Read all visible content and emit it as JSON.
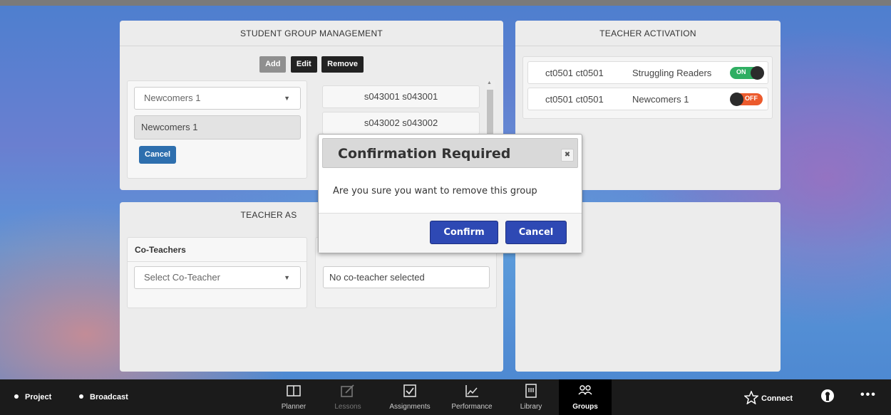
{
  "student_group_management": {
    "title": "STUDENT GROUP MANAGEMENT",
    "buttons": {
      "add": "Add",
      "edit": "Edit",
      "remove": "Remove"
    },
    "group_select": "Newcomers 1",
    "group_name_value": "Newcomers 1",
    "cancel_label": "Cancel",
    "students": [
      "s043001 s043001",
      "s043002 s043002"
    ]
  },
  "teacher_activation": {
    "title": "TEACHER ACTIVATION",
    "rows": [
      {
        "teacher": "ct0501 ct0501",
        "group": "Struggling Readers",
        "state": "ON"
      },
      {
        "teacher": "ct0501 ct0501",
        "group": "Newcomers 1",
        "state": "OFF"
      }
    ],
    "colors": {
      "on": "#2fae62",
      "off": "#ec5a2c"
    }
  },
  "teacher_assignment": {
    "title": "TEACHER AS",
    "co_teachers_label": "Co-Teachers",
    "select_placeholder": "Select Co-Teacher",
    "no_selection": "No co-teacher selected"
  },
  "modal": {
    "title": "Confirmation Required",
    "message": "Are you sure you want to remove this group",
    "close_icon": "close-icon",
    "confirm_label": "Confirm",
    "cancel_label": "Cancel",
    "button_color": "#2e49b4"
  },
  "bottom_nav": {
    "left": [
      {
        "label": "Project"
      },
      {
        "label": "Broadcast"
      }
    ],
    "items": [
      {
        "label": "Planner",
        "icon": "book-icon"
      },
      {
        "label": "Lessons",
        "icon": "edit-icon"
      },
      {
        "label": "Assignments",
        "icon": "checkbox-icon"
      },
      {
        "label": "Performance",
        "icon": "chart-icon"
      },
      {
        "label": "Library",
        "icon": "library-icon"
      },
      {
        "label": "Groups",
        "icon": "groups-icon"
      }
    ],
    "active": "Groups",
    "connect_label": "Connect",
    "more_label": "•••"
  }
}
